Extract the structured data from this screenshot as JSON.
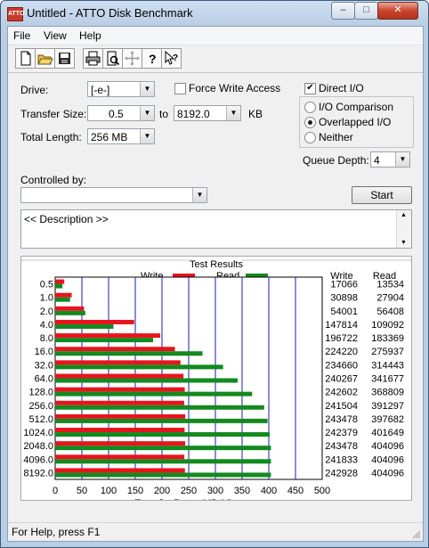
{
  "window": {
    "title": "Untitled - ATTO Disk Benchmark",
    "app_icon_text": "ATTO",
    "controls": {
      "minimize": "–",
      "maximize": "□",
      "close": "✕"
    }
  },
  "menu": {
    "items": [
      "File",
      "View",
      "Help"
    ]
  },
  "toolbar": {
    "buttons": [
      "new-icon",
      "open-icon",
      "save-icon",
      "print-icon",
      "print-preview-icon",
      "move-icon",
      "help-icon",
      "context-help-icon"
    ]
  },
  "settings": {
    "drive_label": "Drive:",
    "drive_value": "[-e-]",
    "force_write_label": "Force Write Access",
    "force_write_checked": false,
    "direct_io_label": "Direct I/O",
    "direct_io_checked": true,
    "transfer_size_label": "Transfer Size:",
    "transfer_from": "0.5",
    "to_label": "to",
    "transfer_to": "8192.0",
    "kb_label": "KB",
    "total_length_label": "Total Length:",
    "total_length_value": "256 MB",
    "io_options": [
      {
        "label": "I/O Comparison",
        "selected": false
      },
      {
        "label": "Overlapped I/O",
        "selected": true
      },
      {
        "label": "Neither",
        "selected": false
      }
    ],
    "queue_depth_label": "Queue Depth:",
    "queue_depth_value": "4",
    "controlled_by_label": "Controlled by:",
    "controlled_by_value": "",
    "start_label": "Start",
    "description_text": "<< Description >>"
  },
  "chart_data": {
    "type": "bar",
    "orientation": "horizontal",
    "title": "Test Results",
    "xlabel": "Transfer Rate - MB / Sec",
    "xlim": [
      0,
      500
    ],
    "x_ticks": [
      "0",
      "50",
      "100",
      "150",
      "200",
      "250",
      "300",
      "350",
      "400",
      "450",
      "500"
    ],
    "categories": [
      "0.5",
      "1.0",
      "2.0",
      "4.0",
      "8.0",
      "16.0",
      "32.0",
      "64.0",
      "128.0",
      "256.0",
      "512.0",
      "1024.0",
      "2048.0",
      "4096.0",
      "8192.0"
    ],
    "series": [
      {
        "name": "Write",
        "color": "#e8141d",
        "values": [
          17.066,
          30.898,
          54.001,
          147.814,
          196.722,
          224.22,
          234.66,
          240.267,
          242.602,
          241.504,
          243.478,
          242.379,
          243.478,
          241.833,
          242.928
        ]
      },
      {
        "name": "Read",
        "color": "#138a1f",
        "values": [
          13.534,
          27.904,
          56.408,
          109.092,
          183.369,
          275.937,
          314.443,
          341.677,
          368.809,
          391.297,
          397.682,
          401.649,
          404.096,
          404.096,
          404.096
        ]
      }
    ],
    "table_headers": {
      "write": "Write",
      "read": "Read"
    },
    "table": {
      "write": [
        "17066",
        "30898",
        "54001",
        "147814",
        "196722",
        "224220",
        "234660",
        "240267",
        "242602",
        "241504",
        "243478",
        "242379",
        "243478",
        "241833",
        "242928"
      ],
      "read": [
        "13534",
        "27904",
        "56408",
        "109092",
        "183369",
        "275937",
        "314443",
        "341677",
        "368809",
        "391297",
        "397682",
        "401649",
        "404096",
        "404096",
        "404096"
      ]
    },
    "legend_position": "top",
    "grid": true,
    "grid_color": "#1b1bb3"
  },
  "status": {
    "text": "For Help, press F1"
  }
}
